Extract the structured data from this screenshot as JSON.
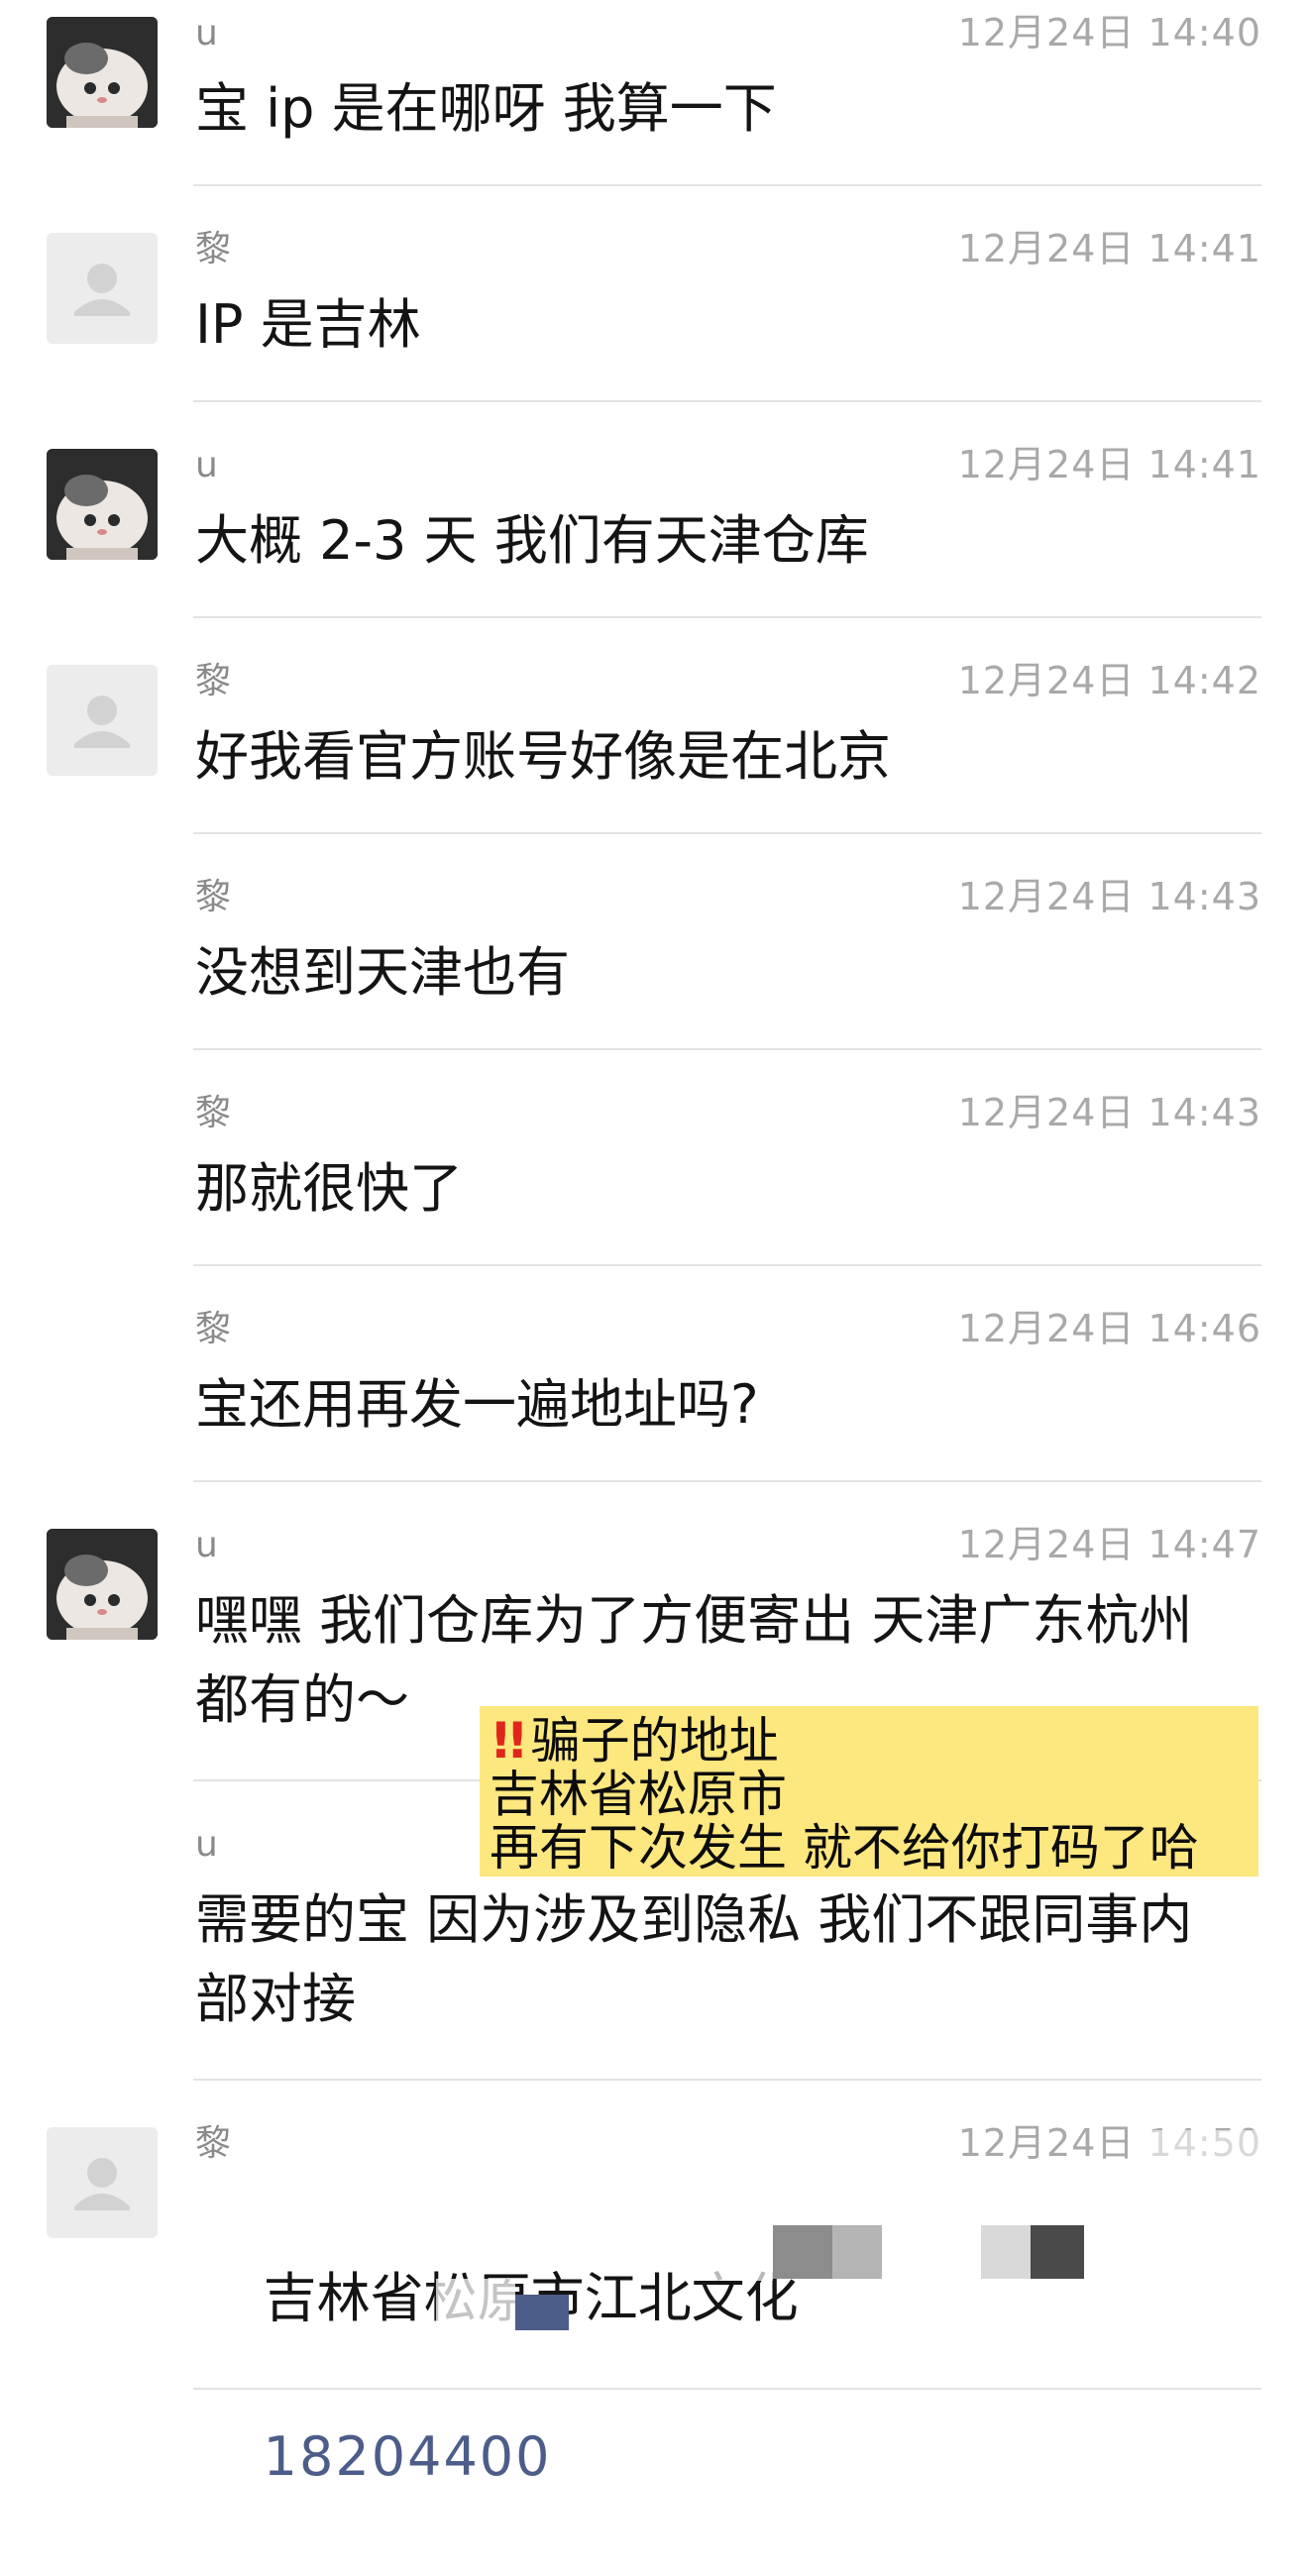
{
  "messages": [
    {
      "sender": "u",
      "time": "12月24日 14:40",
      "text": "宝 ip 是在哪呀 我算一下",
      "avatar": "cat-avatar"
    },
    {
      "sender": "黎",
      "time": "12月24日 14:41",
      "text": "IP 是吉林",
      "avatar": "default-avatar"
    },
    {
      "sender": "u",
      "time": "12月24日 14:41",
      "text": "大概 2-3 天 我们有天津仓库",
      "avatar": "cat-avatar"
    },
    {
      "sender": "黎",
      "time": "12月24日 14:42",
      "text": "好我看官方账号好像是在北京",
      "avatar": "default-avatar"
    },
    {
      "sender": "黎",
      "time": "12月24日 14:43",
      "text": "没想到天津也有",
      "avatar": ""
    },
    {
      "sender": "黎",
      "time": "12月24日 14:43",
      "text": "那就很快了",
      "avatar": ""
    },
    {
      "sender": "黎",
      "time": "12月24日 14:46",
      "text": "宝还用再发一遍地址吗?",
      "avatar": ""
    },
    {
      "sender": "u",
      "time": "12月24日 14:47",
      "text": "嘿嘿 我们仓库为了方便寄出 天津广东杭州\n都有的～",
      "avatar": "cat-avatar"
    },
    {
      "sender": "u",
      "time": "",
      "text": "需要的宝 因为涉及到隐私 我们不跟同事内\n部对接",
      "avatar": ""
    },
    {
      "sender": "黎",
      "time": "12月24日 14:50",
      "text": "吉林省松原市江北文化",
      "phone": "18204400",
      "avatar": "default-avatar"
    }
  ],
  "callout": {
    "icon": "double-exclamation-icon",
    "line1": "骗子的地址",
    "line2": "吉林省松原市",
    "line3": "再有下次发生 就不给你打码了哈"
  },
  "colors": {
    "callout_bg": "#fde77f",
    "sender": "#8a8a8a",
    "time": "#a9a9a9",
    "phone": "#4d5d8a"
  }
}
